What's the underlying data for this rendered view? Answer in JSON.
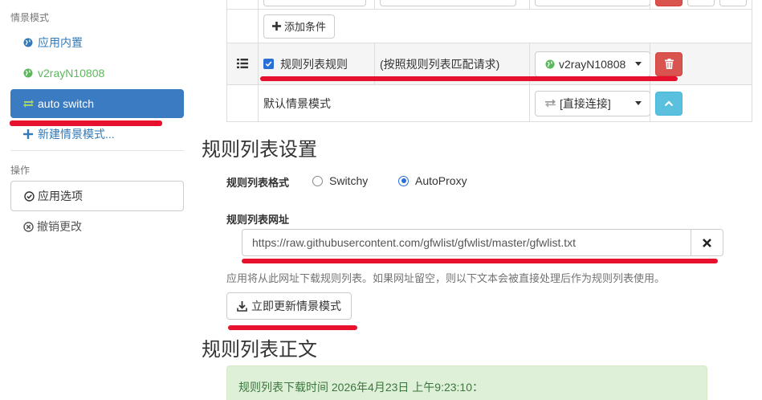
{
  "sidebar": {
    "profiles_header": "情景模式",
    "items": [
      {
        "label": "应用内置",
        "icon": "globe-icon",
        "color": "#337ab7"
      },
      {
        "label": "v2rayN10808",
        "icon": "globe-icon",
        "color": "#5cb85c"
      },
      {
        "label": "auto switch",
        "icon": "retweet-icon",
        "active": true
      },
      {
        "label": "新建情景模式...",
        "icon": "plus-icon"
      }
    ],
    "actions_header": "操作",
    "apply_label": "应用选项",
    "discard_label": "撤销更改"
  },
  "rules_table": {
    "add_condition_label": "添加条件",
    "rule_list_row": {
      "checkbox_label": "规则列表规则",
      "checked": true,
      "description": "(按照规则列表匹配请求)",
      "profile": "v2rayN10808"
    },
    "default_row": {
      "label": "默认情景模式",
      "profile": "[直接连接]"
    }
  },
  "settings": {
    "title": "规则列表设置",
    "format_label": "规则列表格式",
    "format_options": [
      {
        "label": "Switchy",
        "selected": false
      },
      {
        "label": "AutoProxy",
        "selected": true
      }
    ],
    "url_label": "规则列表网址",
    "url_value": "https://raw.githubusercontent.com/gfwlist/gfwlist/master/gfwlist.txt",
    "help_text": "应用将从此网址下载规则列表。如果网址留空，则以下文本会被直接处理后作为规则列表使用。",
    "update_button": "立即更新情景模式"
  },
  "content": {
    "title": "规则列表正文",
    "download_time": "规则列表下载时间 2026年4月23日 上午9:23:10："
  },
  "colors": {
    "active_item": "#3a7bc1",
    "danger": "#d9534f",
    "info": "#5bc0de",
    "success_bg": "#dff0d8",
    "annotation_red": "#e8112d"
  }
}
